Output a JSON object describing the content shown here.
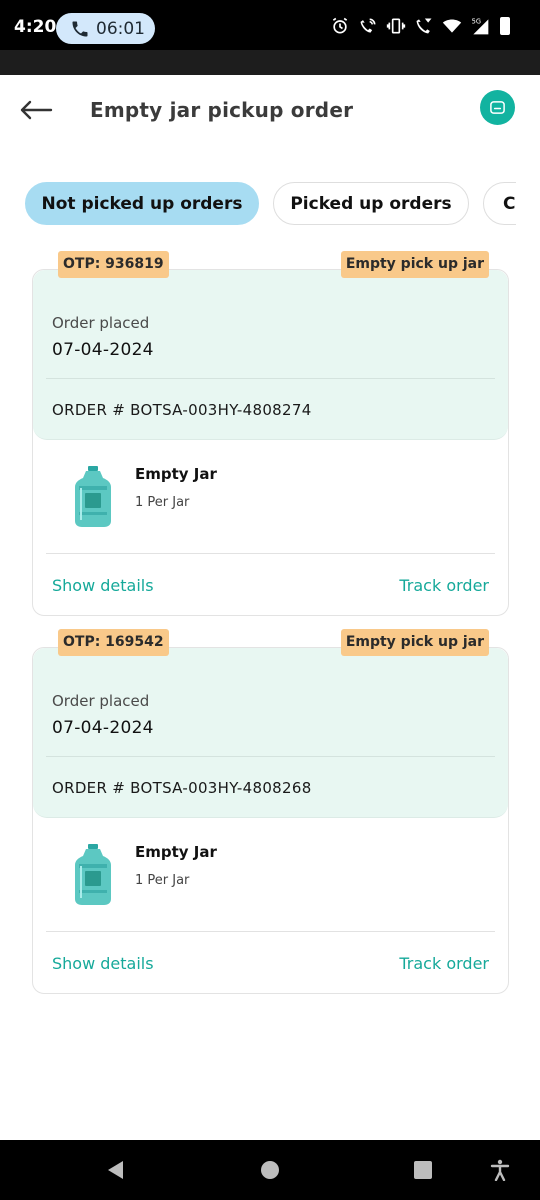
{
  "status_bar": {
    "time": "4:20",
    "call_duration": "06:01",
    "icons": [
      "alarm-icon",
      "call-wifi-icon",
      "vibrate-icon",
      "wifi-calling-icon",
      "wifi-icon",
      "signal-5g-icon",
      "battery-icon"
    ]
  },
  "header": {
    "title": "Empty jar pickup order",
    "back_icon": "arrow-left-icon",
    "chat_icon": "chat-bot-icon"
  },
  "tabs": [
    {
      "label": "Not picked up orders",
      "active": true
    },
    {
      "label": "Picked up orders",
      "active": false
    },
    {
      "label": "C",
      "active": false
    }
  ],
  "orders": [
    {
      "otp": "OTP: 936819",
      "type": "Empty pick up jar",
      "placed_label": "Order placed",
      "placed_date": "07-04-2024",
      "order_number": "ORDER # BOTSA-003HY-4808274",
      "product_name": "Empty Jar",
      "product_qty": "1 Per Jar",
      "show_details": "Show details",
      "track_order": "Track order"
    },
    {
      "otp": "OTP: 169542",
      "type": "Empty pick up jar",
      "placed_label": "Order placed",
      "placed_date": "07-04-2024",
      "order_number": "ORDER # BOTSA-003HY-4808268",
      "product_name": "Empty Jar",
      "product_qty": "1 Per Jar",
      "show_details": "Show details",
      "track_order": "Track order"
    }
  ],
  "colors": {
    "accent": "#12b3a0",
    "tab_active": "#a7dcf2",
    "card_top": "#e8f7f2",
    "badge": "#f9c98a",
    "link": "#16a99a"
  },
  "nav_bar": {
    "icons": [
      "nav-back-icon",
      "nav-home-icon",
      "nav-recents-icon",
      "accessibility-icon"
    ]
  }
}
